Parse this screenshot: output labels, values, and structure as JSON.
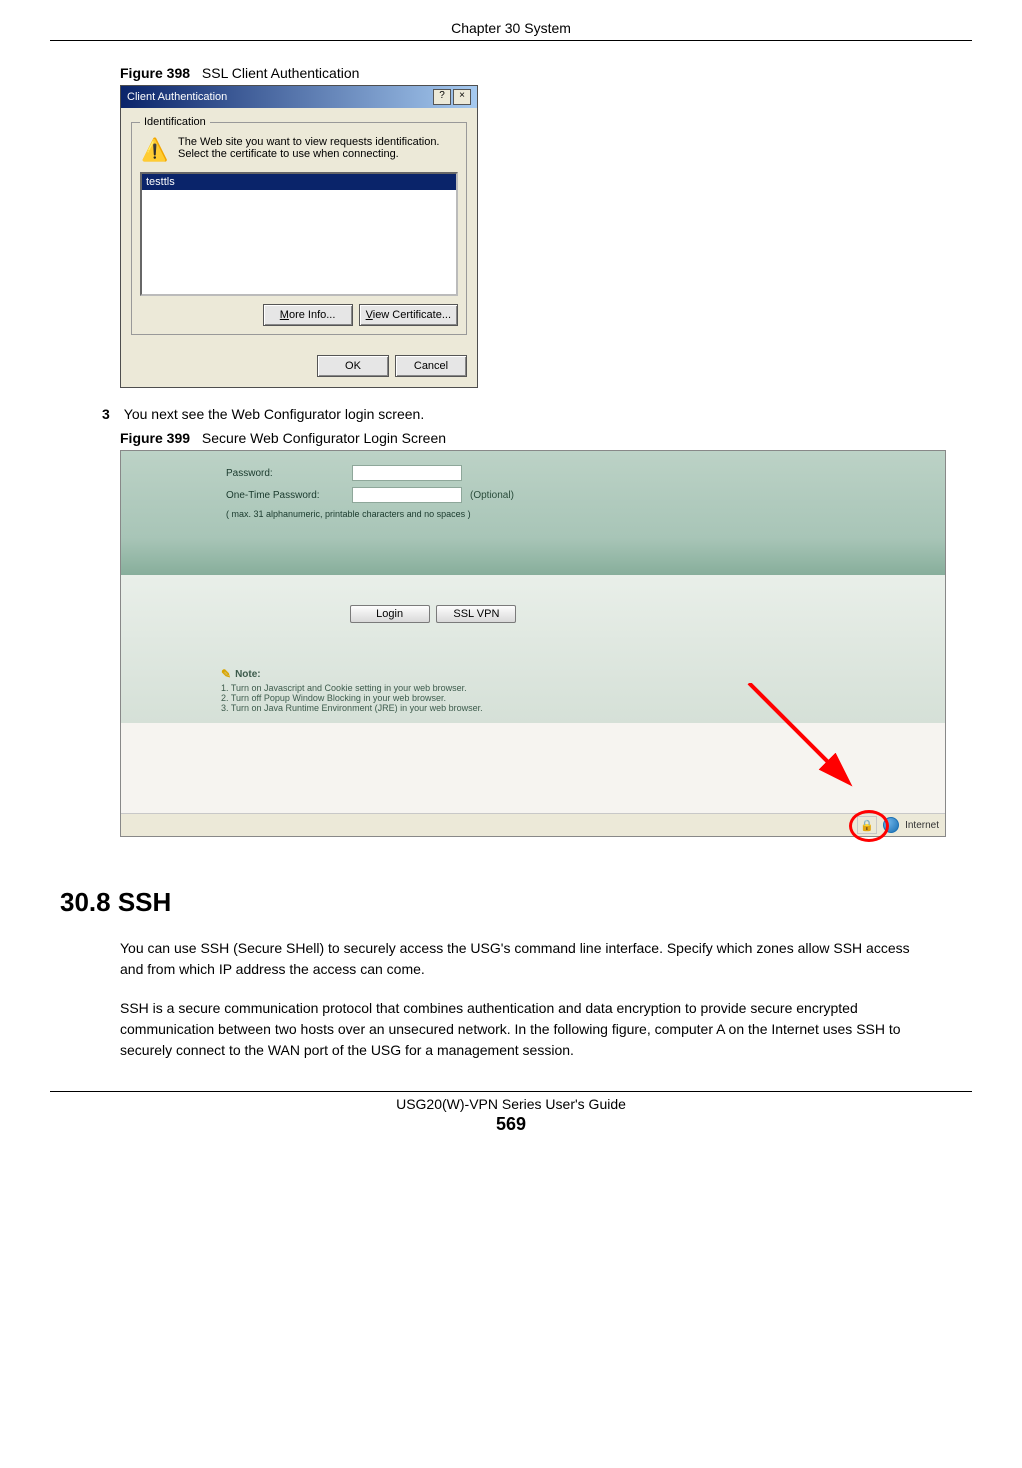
{
  "header": {
    "chapter": "Chapter 30 System"
  },
  "fig398": {
    "caption_num": "Figure 398",
    "caption_title": "SSL Client Authentication",
    "title": "Client Authentication",
    "help_btn": "?",
    "close_btn": "×",
    "legend": "Identification",
    "msg_line1": "The Web site you want to view requests identification.",
    "msg_line2": "Select the certificate to use when connecting.",
    "cert_item": "testtls",
    "more_info": "More Info...",
    "view_cert": "View Certificate...",
    "ok": "OK",
    "cancel": "Cancel"
  },
  "step3": {
    "num": "3",
    "text": "You next see the Web Configurator login screen."
  },
  "fig399": {
    "caption_num": "Figure 399",
    "caption_title": "Secure Web Configurator Login Screen",
    "password_label": "Password:",
    "otp_label": "One-Time Password:",
    "optional": "(Optional)",
    "hint": "( max. 31 alphanumeric, printable characters and no spaces )",
    "login_btn": "Login",
    "sslvpn_btn": "SSL VPN",
    "note_label": "Note:",
    "note1": "1. Turn on Javascript and Cookie setting in your web browser.",
    "note2": "2. Turn off Popup Window Blocking in your web browser.",
    "note3": "3. Turn on Java Runtime Environment (JRE) in your web browser.",
    "status_internet": "Internet"
  },
  "section": {
    "heading": "30.8  SSH",
    "para1": "You can use SSH (Secure SHell) to securely access the USG's command line interface. Specify which zones allow SSH access and from which IP address the access can come.",
    "para2": "SSH is a secure communication protocol that combines authentication and data encryption to provide secure encrypted communication between two hosts over an unsecured network. In the following figure, computer A on the Internet uses SSH to securely connect to the WAN port of the USG for a management session."
  },
  "footer": {
    "guide": "USG20(W)-VPN Series User's Guide",
    "page": "569"
  }
}
